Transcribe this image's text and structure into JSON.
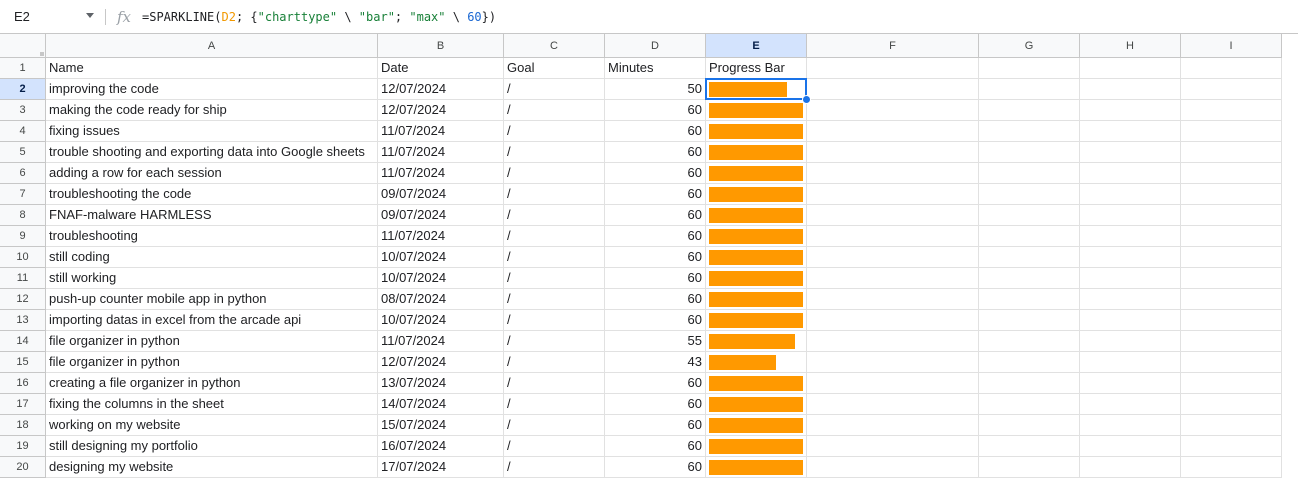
{
  "formula_bar": {
    "name_box": "E2",
    "fx_icon": "function-icon",
    "formula_parts": [
      {
        "text": "=SPARKLINE(",
        "kind": "plain"
      },
      {
        "text": "D2",
        "kind": "ref"
      },
      {
        "text": "; {",
        "kind": "plain"
      },
      {
        "text": "\"charttype\"",
        "kind": "str"
      },
      {
        "text": " \\ ",
        "kind": "plain"
      },
      {
        "text": "\"bar\"",
        "kind": "str"
      },
      {
        "text": "; ",
        "kind": "plain"
      },
      {
        "text": "\"max\"",
        "kind": "str"
      },
      {
        "text": " \\ ",
        "kind": "plain"
      },
      {
        "text": "60",
        "kind": "num"
      },
      {
        "text": "})",
        "kind": "plain"
      }
    ]
  },
  "colors": {
    "bar": "#ff9900",
    "selection": "#1a73e8",
    "header_selected": "#d3e3fd"
  },
  "selected_cell": {
    "column": "E",
    "row": 2
  },
  "sparkline_max": 60,
  "columns": [
    "A",
    "B",
    "C",
    "D",
    "E",
    "F",
    "G",
    "H",
    "I"
  ],
  "header_row": {
    "row_number": "1",
    "cells": [
      "Name",
      "Date",
      "Goal",
      "Minutes",
      "Progress Bar"
    ]
  },
  "rows": [
    {
      "n": "2",
      "name": "improving the code",
      "date": "12/07/2024",
      "goal": "/",
      "minutes": 50
    },
    {
      "n": "3",
      "name": "making the code ready for ship",
      "date": "12/07/2024",
      "goal": "/",
      "minutes": 60
    },
    {
      "n": "4",
      "name": "fixing issues",
      "date": "11/07/2024",
      "goal": "/",
      "minutes": 60
    },
    {
      "n": "5",
      "name": "trouble shooting and exporting data into Google sheets",
      "date": "11/07/2024",
      "goal": "/",
      "minutes": 60
    },
    {
      "n": "6",
      "name": "adding a row for each session",
      "date": "11/07/2024",
      "goal": "/",
      "minutes": 60
    },
    {
      "n": "7",
      "name": "troubleshooting the code",
      "date": "09/07/2024",
      "goal": "/",
      "minutes": 60
    },
    {
      "n": "8",
      "name": "FNAF-malware HARMLESS",
      "date": "09/07/2024",
      "goal": "/",
      "minutes": 60
    },
    {
      "n": "9",
      "name": "troubleshooting",
      "date": "11/07/2024",
      "goal": "/",
      "minutes": 60
    },
    {
      "n": "10",
      "name": "still coding",
      "date": "10/07/2024",
      "goal": "/",
      "minutes": 60
    },
    {
      "n": "11",
      "name": "still working",
      "date": "10/07/2024",
      "goal": "/",
      "minutes": 60
    },
    {
      "n": "12",
      "name": "push-up counter mobile app in python",
      "date": "08/07/2024",
      "goal": "/",
      "minutes": 60
    },
    {
      "n": "13",
      "name": "importing datas in excel from the arcade api",
      "date": "10/07/2024",
      "goal": "/",
      "minutes": 60
    },
    {
      "n": "14",
      "name": "file organizer in python",
      "date": "11/07/2024",
      "goal": "/",
      "minutes": 55
    },
    {
      "n": "15",
      "name": "file organizer in python",
      "date": "12/07/2024",
      "goal": "/",
      "minutes": 43
    },
    {
      "n": "16",
      "name": "creating a file organizer in python",
      "date": "13/07/2024",
      "goal": "/",
      "minutes": 60
    },
    {
      "n": "17",
      "name": "fixing the columns in the sheet",
      "date": "14/07/2024",
      "goal": "/",
      "minutes": 60
    },
    {
      "n": "18",
      "name": "working on my website",
      "date": "15/07/2024",
      "goal": "/",
      "minutes": 60
    },
    {
      "n": "19",
      "name": "still designing my portfolio",
      "date": "16/07/2024",
      "goal": "/",
      "minutes": 60
    },
    {
      "n": "20",
      "name": "designing my website",
      "date": "17/07/2024",
      "goal": "/",
      "minutes": 60
    }
  ]
}
